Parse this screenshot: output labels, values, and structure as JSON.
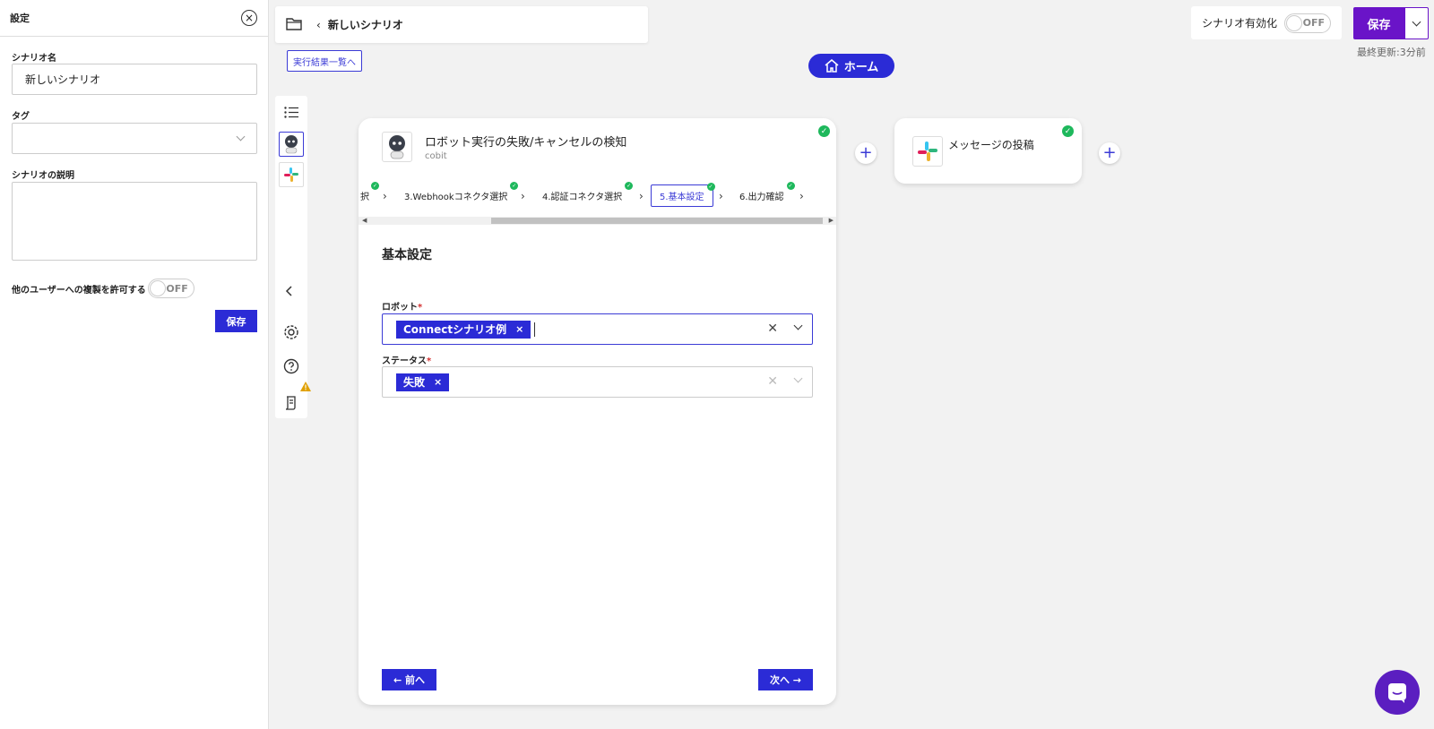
{
  "settings": {
    "title": "設定",
    "scenario_name_label": "シナリオ名",
    "scenario_name_value": "新しいシナリオ",
    "tag_label": "タグ",
    "tag_value": "",
    "description_label": "シナリオの説明",
    "description_value": "",
    "allow_copy_label": "他のユーザーへの複製を許可する",
    "allow_copy_toggle": "OFF",
    "save_label": "保存"
  },
  "top_bar": {
    "scenario_name": "新しいシナリオ",
    "run_results_link": "実行結果一覧へ"
  },
  "home_button": "ホーム",
  "top_right": {
    "enable_label": "シナリオ有効化",
    "enable_toggle": "OFF",
    "save_label": "保存",
    "last_updated": "最終更新:3分前"
  },
  "card": {
    "title": "ロボット実行の失敗/キャンセルの検知",
    "subtitle": "cobit",
    "steps": [
      "択",
      "3.Webhookコネクタ選択",
      "4.認証コネクタ選択",
      "5.基本設定",
      "6.出力確認"
    ],
    "active_step": "5.基本設定",
    "section_title": "基本設定",
    "robot_label": "ロボット",
    "robot_chip": "Connectシナリオ例",
    "status_label": "ステータス",
    "status_chip": "失敗",
    "required_mark": "*",
    "chip_remove": "×",
    "clear_symbol": "✕",
    "prev_label": "← 前へ",
    "next_label": "次へ →"
  },
  "slack_node": {
    "title": "メッセージの投稿"
  },
  "colors": {
    "primary": "#2b2bd6",
    "save_purple": "#6a14c8",
    "success": "#1eb85c"
  }
}
